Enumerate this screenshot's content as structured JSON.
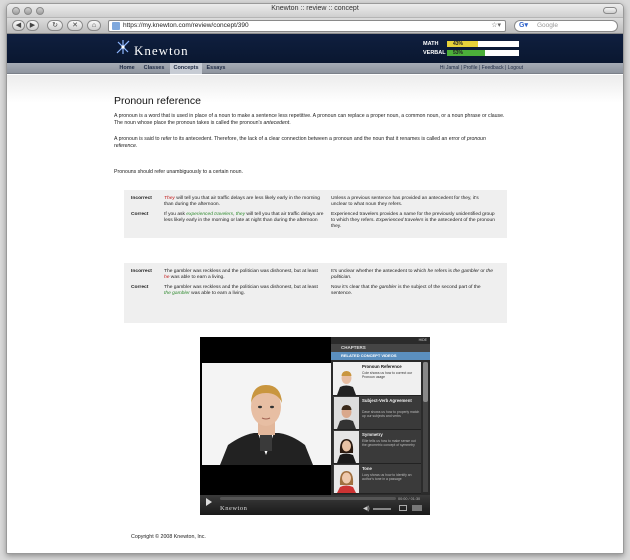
{
  "window": {
    "title": "Knewton :: review :: concept"
  },
  "browser": {
    "url": "https://my.knewton.com/review/concept/390",
    "search_placeholder": "Google",
    "back": "◀",
    "forward": "▶",
    "reload": "↻",
    "stop": "✕",
    "home": "⌂",
    "plus": "+"
  },
  "header": {
    "logo": "Knewton",
    "scores": [
      {
        "label": "MATH",
        "value": "43%",
        "fraction": 0.43,
        "color": "#e8d23a"
      },
      {
        "label": "VERBAL",
        "value": "53%",
        "fraction": 0.53,
        "color": "#4caf3a"
      }
    ]
  },
  "nav": {
    "tabs": [
      "Home",
      "Classes",
      "Concepts",
      "Essays"
    ],
    "active": "Concepts",
    "greeting": "Hi Jamal",
    "links": [
      "Profile",
      "Feedback",
      "Logout"
    ]
  },
  "content": {
    "title": "Pronoun reference",
    "p1_a": "A pronoun is a word that is used in place of a noun to make a sentence less repetitive. A pronoun can replace a proper noun, a common noun, or a noun phrase or clause. The noun whose place the pronoun takes is called the pronoun's ",
    "p1_em": "antecedent",
    "p1_b": ".",
    "p2_a": "A pronoun is said to ",
    "p2_em1": "refer",
    "p2_b": " to its antecedent. Therefore, the lack of a clear connection between a pronoun and the noun that it renames is called an error of ",
    "p2_em2": "pronoun reference",
    "p2_c": ".",
    "p3": "Pronouns should refer unambiguously to a certain noun.",
    "ex1": {
      "incorrect_label": "Incorrect",
      "inc_red": "They",
      "inc_text": " will tell you that air traffic delays are less likely early in the morning than during the afternoon.",
      "inc_note": "Unless a previous sentence has provided an antecedent for they, it's unclear to what noun they refers.",
      "correct_label": "Correct",
      "cor_a": "If you ask ",
      "cor_green1": "experienced travelers",
      "cor_b": ", ",
      "cor_green2": "they",
      "cor_c": " will tell you that air traffic delays are less likely early in the morning or late at night than during the afternoon",
      "cor_note_a": "Experienced travelers provides a name for the previously unidentified group to which they refers. ",
      "cor_note_em": "Experienced travelers",
      "cor_note_b": " is the antecedent of the pronoun they."
    },
    "ex2": {
      "incorrect_label": "Incorrect",
      "inc_a": "The gambler was reckless and the politician was dishonest, but at least ",
      "inc_red": "he",
      "inc_b": " was able to earn a living.",
      "inc_note_a": "It's unclear whether the antecedent to which ",
      "inc_note_em1": "he",
      "inc_note_b": " refers is ",
      "inc_note_em2": "the gambler",
      "inc_note_c": " or ",
      "inc_note_em3": "the politician",
      "inc_note_d": ".",
      "correct_label": "Correct",
      "cor_a": "The gambler was reckless and the politician was dishonest, but at least ",
      "cor_green": "the gambler",
      "cor_b": " was able to earn a living.",
      "cor_note_a": "Now it's clear that ",
      "cor_note_em": "the gambler",
      "cor_note_b": " is the subject of the second part of the sentence."
    }
  },
  "video": {
    "hide_label": "HIDE",
    "chapters_label": "CHAPTERS",
    "related_label": "RELATED CONCEPT VIDEOS",
    "items": [
      {
        "title": "Pronoun Reference",
        "desc": "Cole shows us how to correct our Pronoun usage"
      },
      {
        "title": "Subject-Verb Agreement",
        "desc": "Dave shows us how to properly match up our subjects and verbs"
      },
      {
        "title": "Symmetry",
        "desc": "Ellie tells us how to make sense out the geometric concept of symmetry"
      },
      {
        "title": "Tone",
        "desc": "Lucy shows us how to identify an author's tone in a passage"
      }
    ],
    "time": "00:00 / 01:30",
    "brand": "Knewton",
    "progress": 0.0
  },
  "footer": {
    "copyright": "Copyright © 2008 Knewton, Inc."
  }
}
